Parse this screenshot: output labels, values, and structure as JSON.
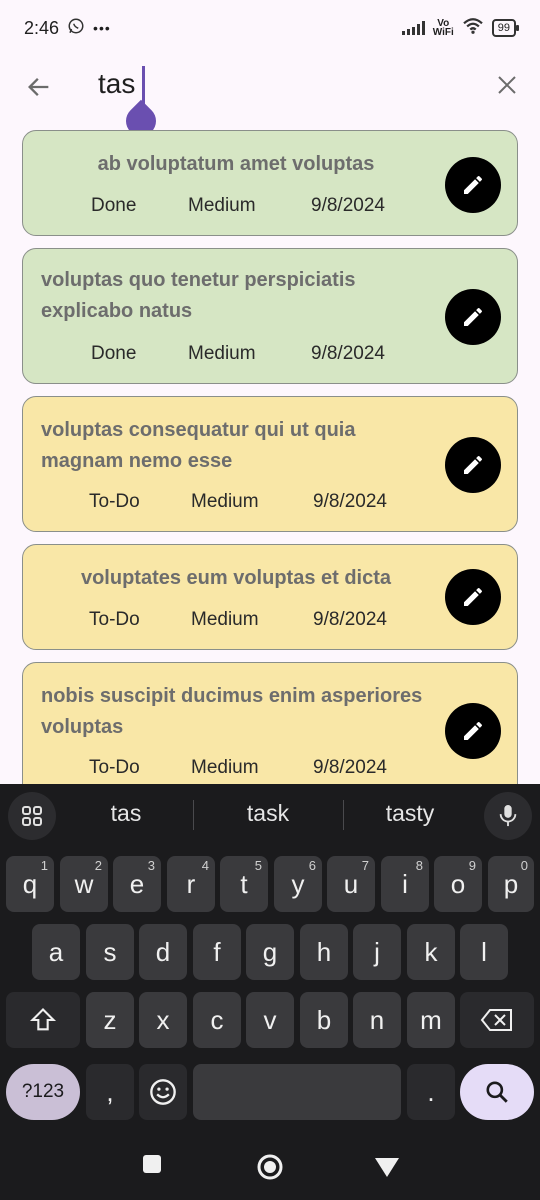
{
  "status_bar": {
    "time": "2:46",
    "dots": "•••",
    "vowifi": "Vo\nWiFi",
    "battery": "99"
  },
  "search": {
    "query": "tas",
    "back_icon": "arrow-back-icon",
    "clear_icon": "close-icon"
  },
  "tasks": [
    {
      "title": "ab voluptatum amet voluptas",
      "status": "Done",
      "priority": "Medium",
      "date": "9/8/2024",
      "color": "#d6e6c4"
    },
    {
      "title": "voluptas quo tenetur perspiciatis explicabo natus",
      "status": "Done",
      "priority": "Medium",
      "date": "9/8/2024",
      "color": "#d6e6c4"
    },
    {
      "title": "voluptas consequatur qui ut quia magnam nemo esse",
      "status": "To-Do",
      "priority": "Medium",
      "date": "9/8/2024",
      "color": "#f9e7a7"
    },
    {
      "title": "voluptates eum voluptas et dicta",
      "status": "To-Do",
      "priority": "Medium",
      "date": "9/8/2024",
      "color": "#f9e7a7"
    },
    {
      "title": "nobis suscipit ducimus enim asperiores voluptas",
      "status": "To-Do",
      "priority": "Medium",
      "date": "9/8/2024",
      "color": "#f9e7a7"
    }
  ],
  "keyboard": {
    "suggestions": [
      "tas",
      "task",
      "tasty"
    ],
    "row1": [
      {
        "k": "q",
        "n": "1"
      },
      {
        "k": "w",
        "n": "2"
      },
      {
        "k": "e",
        "n": "3"
      },
      {
        "k": "r",
        "n": "4"
      },
      {
        "k": "t",
        "n": "5"
      },
      {
        "k": "y",
        "n": "6"
      },
      {
        "k": "u",
        "n": "7"
      },
      {
        "k": "i",
        "n": "8"
      },
      {
        "k": "o",
        "n": "9"
      },
      {
        "k": "p",
        "n": "0"
      }
    ],
    "row2": [
      "a",
      "s",
      "d",
      "f",
      "g",
      "h",
      "j",
      "k",
      "l"
    ],
    "row3": [
      "z",
      "x",
      "c",
      "v",
      "b",
      "n",
      "m"
    ],
    "sym_label": "?123",
    "comma": ",",
    "period": "."
  }
}
